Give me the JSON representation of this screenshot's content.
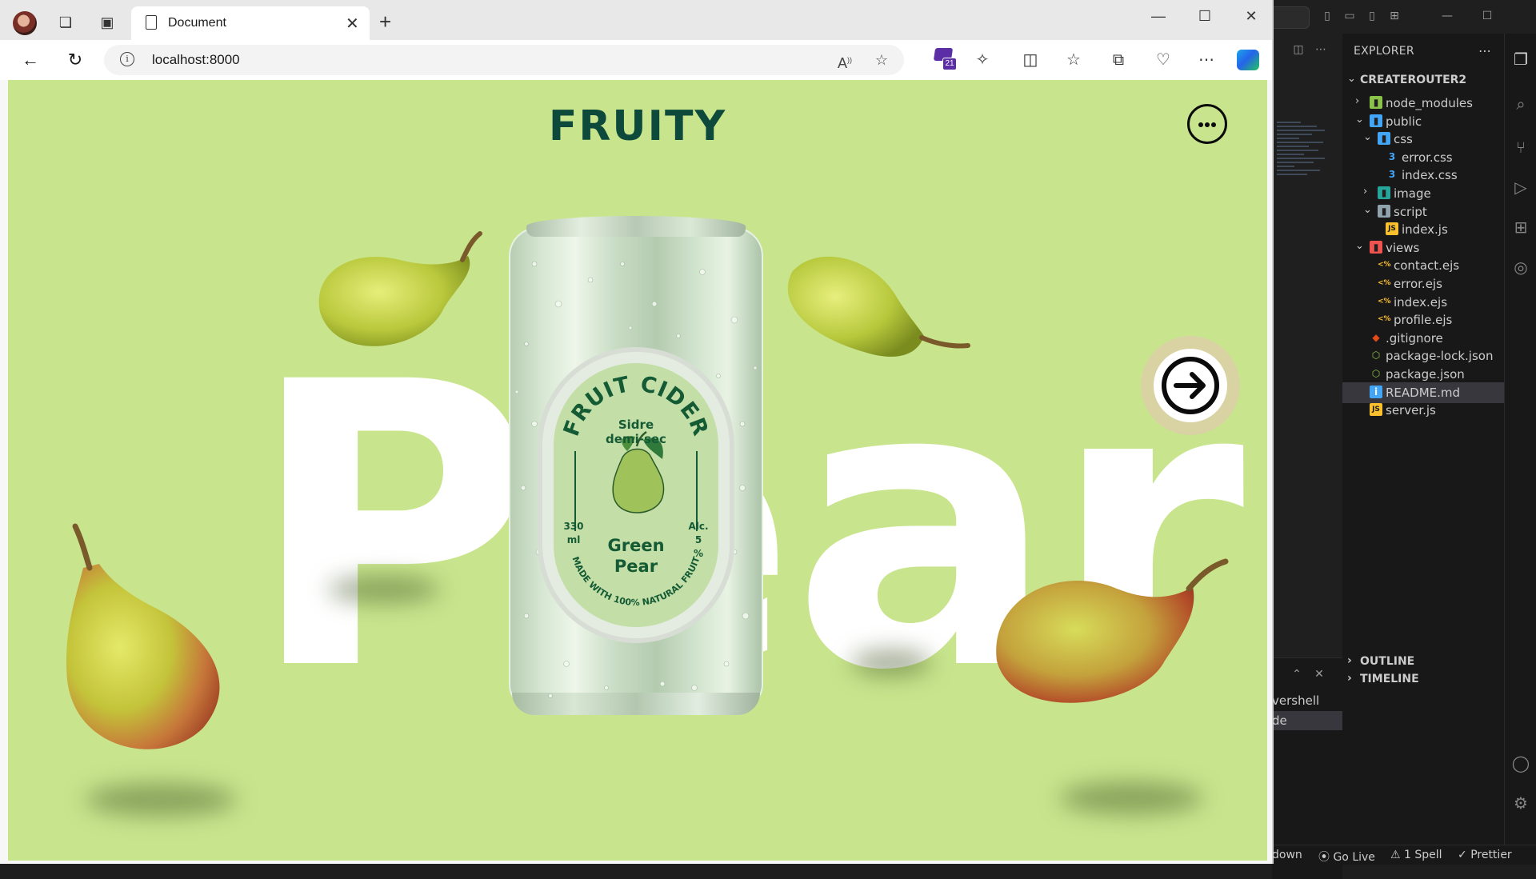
{
  "browser": {
    "tab_title": "Document",
    "url": "localhost:8000",
    "extension_badge": "21"
  },
  "page": {
    "brand": "FRUITY",
    "fruit_word": "Pear",
    "can": {
      "arc_text": "FRUIT CIDER",
      "subtitle_1": "Sidre",
      "subtitle_2": "demi-sec",
      "volume_1": "330",
      "volume_2": "ml",
      "alc_1": "Alc.",
      "alc_2": "5",
      "alc_3": "%",
      "name_1": "Green",
      "name_2": "Pear",
      "bottom_arc": "MADE WITH 100% NATURAL FRUIT"
    },
    "colors": {
      "page_bg": "#c8e58d",
      "brand": "#0d4a3c",
      "label_green": "#145a34"
    }
  },
  "vscode": {
    "explorer_title": "EXPLORER",
    "project": "CREATEROUTER2",
    "tree": [
      {
        "label": "node_modules",
        "indent": 1,
        "chev": "right",
        "icon": "folder-node-icon"
      },
      {
        "label": "public",
        "indent": 1,
        "chev": "down",
        "icon": "folder-public-icon"
      },
      {
        "label": "css",
        "indent": 2,
        "chev": "down",
        "icon": "folder-css-icon"
      },
      {
        "label": "error.css",
        "indent": 3,
        "icon": "css-file-icon"
      },
      {
        "label": "index.css",
        "indent": 3,
        "icon": "css-file-icon"
      },
      {
        "label": "image",
        "indent": 2,
        "chev": "right",
        "icon": "folder-image-icon"
      },
      {
        "label": "script",
        "indent": 2,
        "chev": "down",
        "icon": "folder-script-icon"
      },
      {
        "label": "index.js",
        "indent": 3,
        "icon": "js-file-icon"
      },
      {
        "label": "views",
        "indent": 1,
        "chev": "down",
        "icon": "folder-views-icon"
      },
      {
        "label": "contact.ejs",
        "indent": 2,
        "icon": "ejs-file-icon"
      },
      {
        "label": "error.ejs",
        "indent": 2,
        "icon": "ejs-file-icon"
      },
      {
        "label": "index.ejs",
        "indent": 2,
        "icon": "ejs-file-icon"
      },
      {
        "label": "profile.ejs",
        "indent": 2,
        "icon": "ejs-file-icon"
      },
      {
        "label": ".gitignore",
        "indent": 1,
        "icon": "git-file-icon"
      },
      {
        "label": "package-lock.json",
        "indent": 1,
        "icon": "node-file-icon"
      },
      {
        "label": "package.json",
        "indent": 1,
        "icon": "node-file-icon"
      },
      {
        "label": "README.md",
        "indent": 1,
        "icon": "info-file-icon",
        "selected": true
      },
      {
        "label": "server.js",
        "indent": 1,
        "icon": "js-file-icon"
      }
    ],
    "outline": "OUTLINE",
    "timeline": "TIMELINE",
    "panel_tab_1": "vershell",
    "panel_tab_2": "de",
    "status": {
      "markdown": "down",
      "golive": "Go Live",
      "spell": "1 Spell",
      "prettier": "Prettier"
    }
  }
}
